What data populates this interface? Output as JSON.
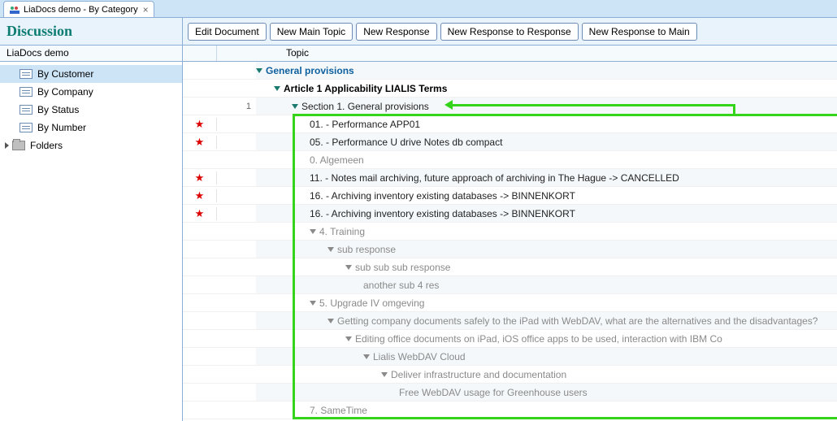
{
  "tab": {
    "label": "LiaDocs demo - By Category"
  },
  "header": {
    "title": "Discussion",
    "breadcrumb": "LiaDocs demo"
  },
  "toolbar": {
    "edit": "Edit Document",
    "newMain": "New Main Topic",
    "newResponse": "New Response",
    "newRespResp": "New Response to Response",
    "newRespMain": "New Response to Main"
  },
  "columns": {
    "topic": "Topic"
  },
  "sidebar": {
    "items": [
      {
        "label": "By Customer",
        "selected": true
      },
      {
        "label": "By Company"
      },
      {
        "label": "By Status"
      },
      {
        "label": "By Number"
      }
    ],
    "folders": "Folders"
  },
  "rows": [
    {
      "star": "",
      "num": "",
      "indent": 0,
      "tw": "green",
      "cls": "bold-blue",
      "text": "General provisions"
    },
    {
      "star": "",
      "num": "",
      "indent": 1,
      "tw": "green",
      "cls": "bold-black",
      "text": "Article 1 Applicability LIALIS Terms"
    },
    {
      "star": "",
      "num": "1",
      "indent": 2,
      "tw": "green",
      "cls": "",
      "text": "Section 1. General provisions"
    },
    {
      "star": "★",
      "num": "",
      "indent": 3,
      "tw": "",
      "cls": "",
      "text": "01. - Performance APP01"
    },
    {
      "star": "★",
      "num": "",
      "indent": 3,
      "tw": "",
      "cls": "",
      "text": "05. - Performance U drive Notes db compact"
    },
    {
      "star": "",
      "num": "",
      "indent": 3,
      "tw": "",
      "cls": "grey",
      "text": "0. Algemeen"
    },
    {
      "star": "★",
      "num": "",
      "indent": 3,
      "tw": "",
      "cls": "",
      "text": "11. - Notes mail archiving, future approach of archiving in The Hague -> CANCELLED"
    },
    {
      "star": "★",
      "num": "",
      "indent": 3,
      "tw": "",
      "cls": "",
      "text": "16. - Archiving inventory existing databases -> BINNENKORT"
    },
    {
      "star": "★",
      "num": "",
      "indent": 3,
      "tw": "",
      "cls": "",
      "text": "16. - Archiving inventory existing databases -> BINNENKORT"
    },
    {
      "star": "",
      "num": "",
      "indent": 3,
      "tw": "gray",
      "cls": "grey",
      "text": "4. Training"
    },
    {
      "star": "",
      "num": "",
      "indent": 4,
      "tw": "gray",
      "cls": "grey",
      "text": "sub response"
    },
    {
      "star": "",
      "num": "",
      "indent": 5,
      "tw": "gray",
      "cls": "grey",
      "text": "sub sub sub response"
    },
    {
      "star": "",
      "num": "",
      "indent": 6,
      "tw": "",
      "cls": "grey",
      "text": "another sub 4 res"
    },
    {
      "star": "",
      "num": "",
      "indent": 3,
      "tw": "gray",
      "cls": "grey",
      "text": "5. Upgrade IV omgeving"
    },
    {
      "star": "",
      "num": "",
      "indent": 4,
      "tw": "gray",
      "cls": "grey",
      "text": "Getting company documents safely to the iPad with WebDAV, what are the alternatives and the disadvantages?"
    },
    {
      "star": "",
      "num": "",
      "indent": 5,
      "tw": "gray",
      "cls": "grey",
      "text": "Editing office documents on iPad, iOS office apps to be used, interaction with IBM Co"
    },
    {
      "star": "",
      "num": "",
      "indent": 6,
      "tw": "gray",
      "cls": "grey",
      "text": "Lialis WebDAV Cloud"
    },
    {
      "star": "",
      "num": "",
      "indent": 7,
      "tw": "gray",
      "cls": "grey",
      "text": "Deliver infrastructure and documentation"
    },
    {
      "star": "",
      "num": "",
      "indent": 8,
      "tw": "",
      "cls": "grey",
      "text": "Free WebDAV usage for Greenhouse users"
    },
    {
      "star": "",
      "num": "",
      "indent": 3,
      "tw": "",
      "cls": "grey",
      "text": "7. SameTime"
    }
  ]
}
